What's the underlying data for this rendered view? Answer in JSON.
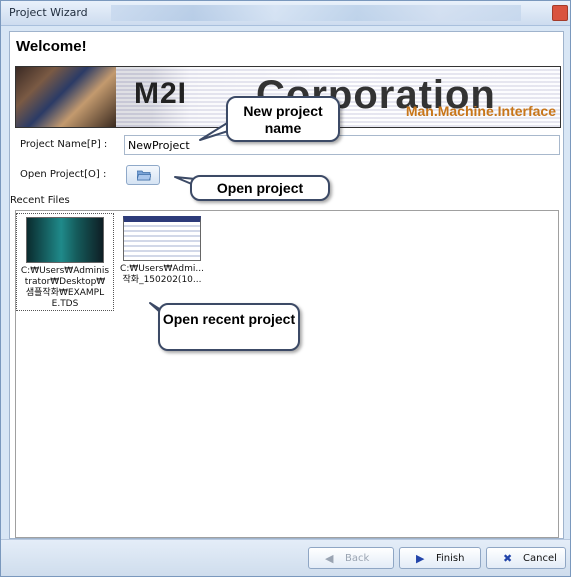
{
  "window": {
    "title": "Project Wizard"
  },
  "header": {
    "title": "Welcome!"
  },
  "banner": {
    "logo": "M2I",
    "company": "Corporation",
    "tagline": "Man.Machine.Interface"
  },
  "form": {
    "project_name_label": "Project Name[P] :",
    "project_name_value": "NewProject",
    "open_project_label": "Open Project[O] :",
    "open_icon": "folder-icon"
  },
  "recent": {
    "label": "Recent Files",
    "files": [
      {
        "line1": "C:₩Users₩Adminis",
        "line2": "trator₩Desktop₩",
        "line3": "샘플작화₩EXAMPL",
        "line4": "E.TDS",
        "thumb_color": "#1f8a8a"
      },
      {
        "line1": "C:₩Users₩Admi...",
        "line2": "작화_150202(10...",
        "line3": "",
        "line4": "",
        "thumb_color": "#2d3b7a"
      }
    ]
  },
  "footer": {
    "back_label": "Back",
    "finish_label": "Finish",
    "cancel_label": "Cancel"
  },
  "callouts": {
    "new_project": "New project name",
    "open_project": "Open project",
    "open_recent": "Open recent project"
  },
  "colors": {
    "accent": "#3c4a66",
    "finish_arrow": "#2244aa",
    "cancel_x": "#2244aa",
    "tagline": "#c8761a"
  }
}
